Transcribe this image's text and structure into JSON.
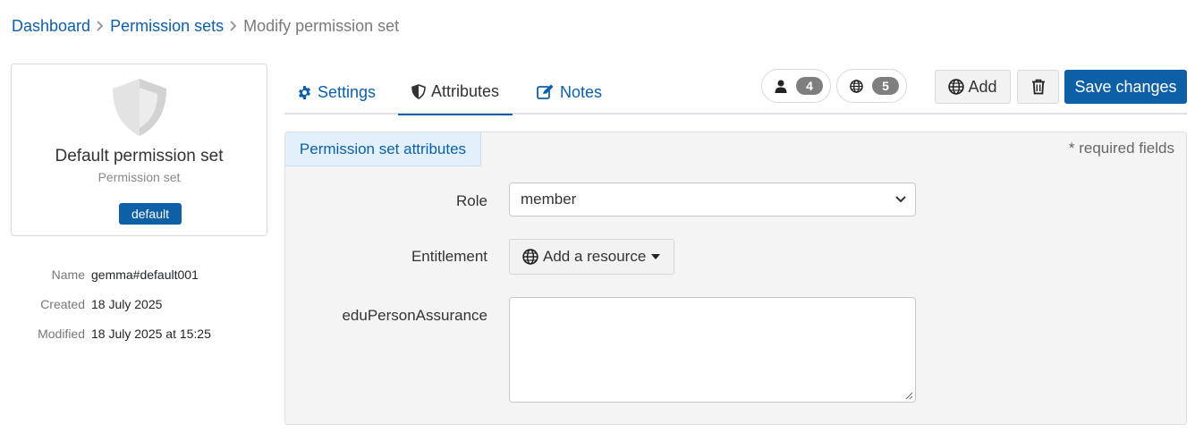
{
  "breadcrumb": {
    "items": [
      "Dashboard",
      "Permission sets"
    ],
    "current": "Modify permission set"
  },
  "card": {
    "icon": "shield-icon",
    "title": "Default permission set",
    "subtitle": "Permission set",
    "badge": "default"
  },
  "meta": [
    {
      "key": "Name",
      "value": "gemma#default001"
    },
    {
      "key": "Created",
      "value": "18 July 2025"
    },
    {
      "key": "Modified",
      "value": "18 July 2025 at 15:25"
    }
  ],
  "tabs": [
    {
      "label": "Settings",
      "icon": "gear-icon",
      "active": false
    },
    {
      "label": "Attributes",
      "icon": "shield-half-icon",
      "active": true
    },
    {
      "label": "Notes",
      "icon": "edit-icon",
      "active": false
    }
  ],
  "counters": {
    "users": "4",
    "resources": "5"
  },
  "toolbar": {
    "add_label": "Add",
    "save_label": "Save changes"
  },
  "panel": {
    "title": "Permission set attributes",
    "required_note": "* required fields",
    "fields": {
      "role_label": "Role",
      "role_value": "member",
      "entitlement_label": "Entitlement",
      "entitlement_button": "Add a resource",
      "assurance_label": "eduPersonAssurance",
      "assurance_value": ""
    }
  },
  "colors": {
    "primary": "#0d5fa6",
    "panel_bg": "#f4f4f4",
    "panel_head_bg": "#e1f0fa",
    "badge_gray": "#7e7e7e"
  }
}
